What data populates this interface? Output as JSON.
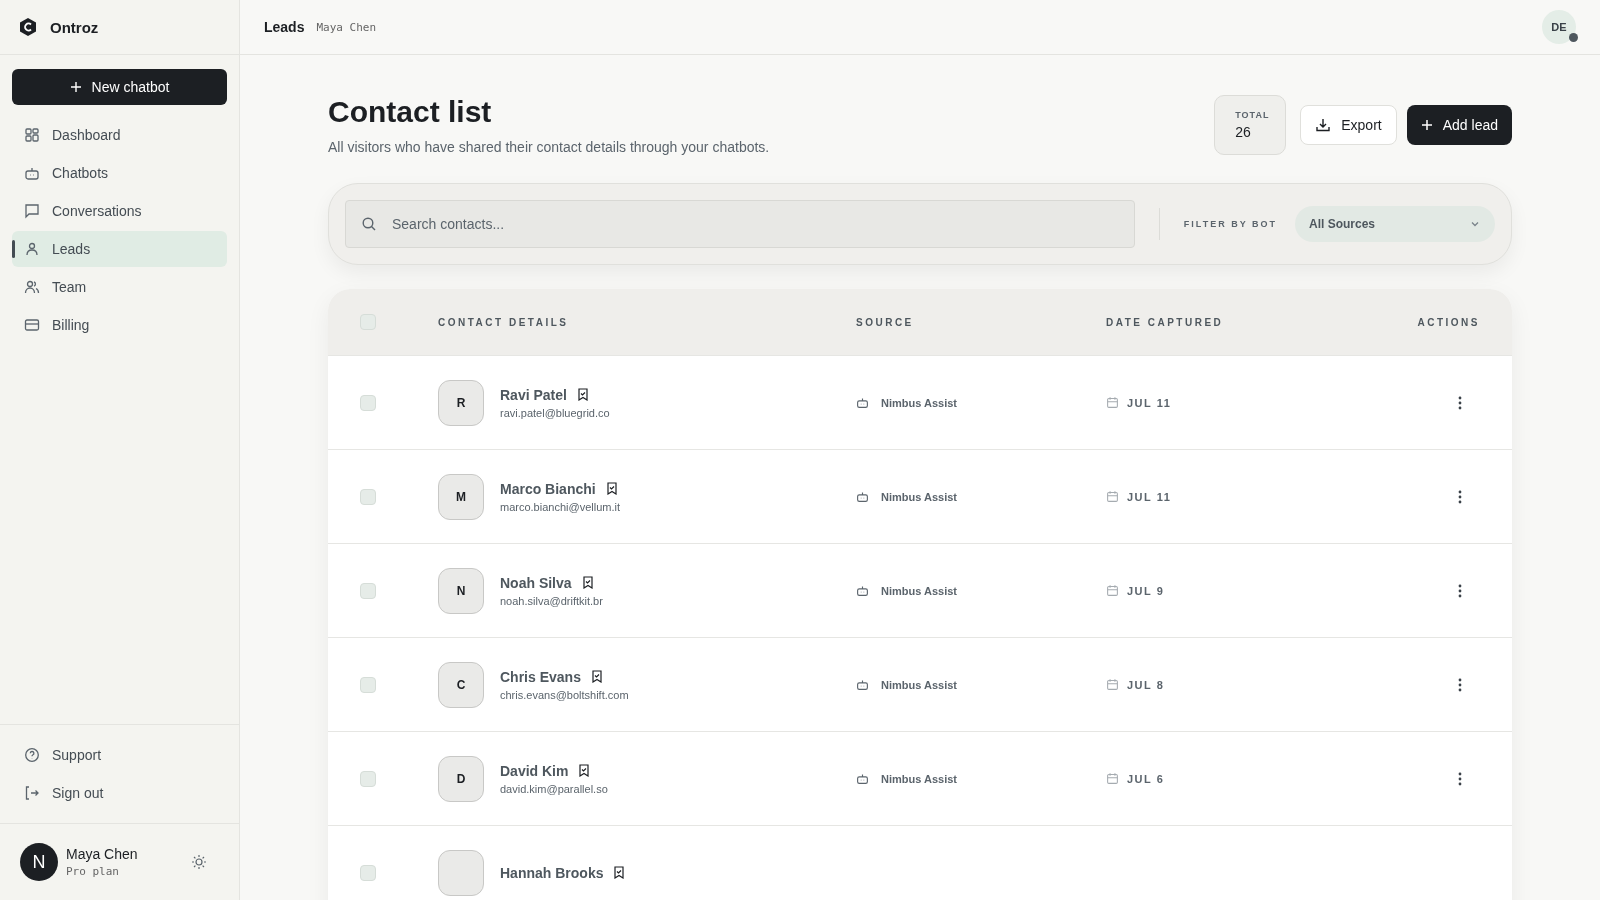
{
  "brand": "Ontroz",
  "new_chatbot": "New chatbot",
  "sidebar": {
    "items": [
      {
        "label": "Dashboard",
        "kind": "grid",
        "selected": false
      },
      {
        "label": "Chatbots",
        "kind": "bot",
        "selected": false
      },
      {
        "label": "Conversations",
        "kind": "chat",
        "selected": false
      },
      {
        "label": "Leads",
        "kind": "user",
        "selected": true
      },
      {
        "label": "Team",
        "kind": "users",
        "selected": false
      },
      {
        "label": "Billing",
        "kind": "card",
        "selected": false
      }
    ],
    "footer_items": [
      {
        "label": "Support",
        "kind": "help"
      },
      {
        "label": "Sign out",
        "kind": "signout"
      }
    ],
    "user": {
      "initial": "N",
      "name": "Maya Chen",
      "plan": "Pro plan"
    }
  },
  "header": {
    "title": "Leads",
    "subtitle": "Maya Chen",
    "avatar": "DE"
  },
  "page": {
    "title": "Contact list",
    "description": "All visitors who have shared their contact details through your chatbots.",
    "total_label": "TOTAL",
    "total": "26",
    "export": "Export",
    "add_lead": "Add lead"
  },
  "filters": {
    "search_placeholder": "Search contacts...",
    "filter_label": "FILTER BY BOT",
    "source": "All Sources"
  },
  "table": {
    "select_all_checked": false,
    "columns": [
      "CONTACT DETAILS",
      "SOURCE",
      "DATE CAPTURED",
      "ACTIONS"
    ],
    "rows": [
      {
        "initial": "R",
        "name": "Ravi Patel",
        "email": "ravi.patel@bluegrid.co",
        "source": "Nimbus Assist",
        "date": "JUL 11",
        "checked": false
      },
      {
        "initial": "M",
        "name": "Marco Bianchi",
        "email": "marco.bianchi@vellum.it",
        "source": "Nimbus Assist",
        "date": "JUL 11",
        "checked": false
      },
      {
        "initial": "N",
        "name": "Noah Silva",
        "email": "noah.silva@driftkit.br",
        "source": "Nimbus Assist",
        "date": "JUL 9",
        "checked": false
      },
      {
        "initial": "C",
        "name": "Chris Evans",
        "email": "chris.evans@boltshift.com",
        "source": "Nimbus Assist",
        "date": "JUL 8",
        "checked": false
      },
      {
        "initial": "D",
        "name": "David Kim",
        "email": "david.kim@parallel.so",
        "source": "Nimbus Assist",
        "date": "JUL 6",
        "checked": false
      },
      {
        "name": "Hannah Brooks",
        "checked": false
      }
    ]
  }
}
